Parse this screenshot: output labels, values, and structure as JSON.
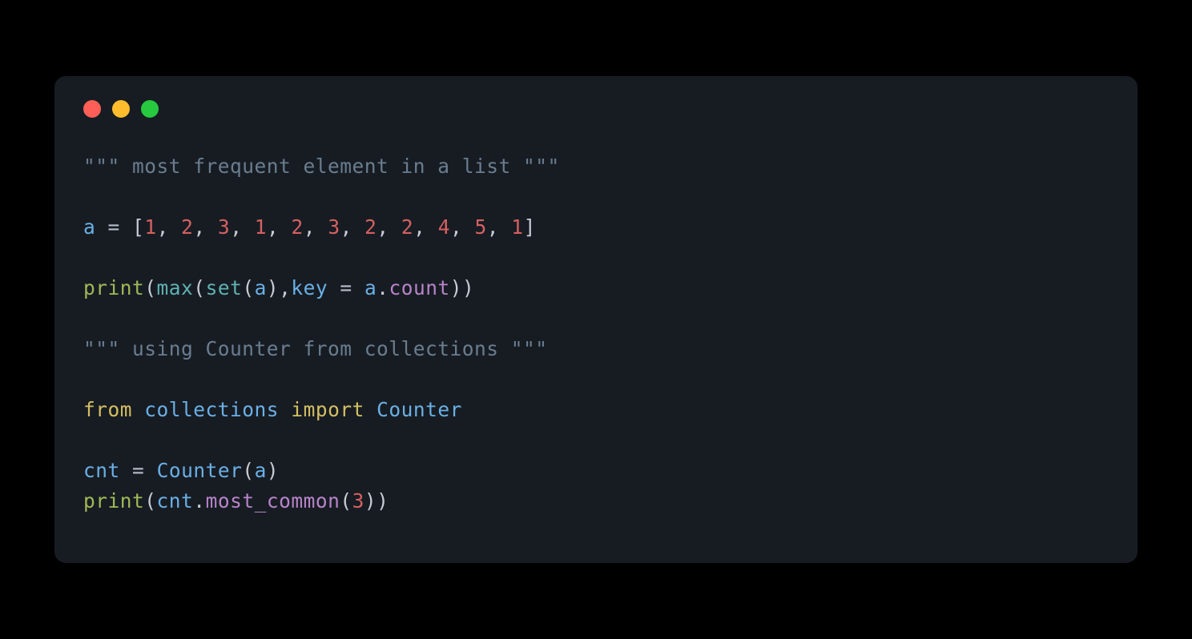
{
  "window": {
    "traffic_lights": [
      "close",
      "minimize",
      "zoom"
    ]
  },
  "code": {
    "comment1_open": "\"\"\"",
    "comment1_text": " most frequent element in a list ",
    "comment1_close": "\"\"\"",
    "var_a": "a",
    "assign": "=",
    "lbracket": "[",
    "rbracket": "]",
    "list_values": [
      "1",
      "2",
      "3",
      "1",
      "2",
      "3",
      "2",
      "2",
      "4",
      "5",
      "1"
    ],
    "comma": ",",
    "fn_print": "print",
    "fn_max": "max",
    "fn_set": "set",
    "kw_key": "key",
    "dot": ".",
    "method_count": "count",
    "lparen": "(",
    "rparen": ")",
    "comment2_open": "\"\"\"",
    "comment2_text": " using Counter from collections ",
    "comment2_close": "\"\"\"",
    "kw_from": "from",
    "mod_collections": "collections",
    "kw_import": "import",
    "cls_counter": "Counter",
    "var_cnt": "cnt",
    "method_most_common": "most_common",
    "num_3": "3"
  }
}
